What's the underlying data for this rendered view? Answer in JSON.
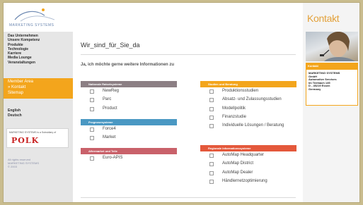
{
  "logo": {
    "text": "MARKETING SYSTEMS"
  },
  "nav": {
    "items": [
      "Das Unternehmen",
      "Unsere Kompetenz",
      "Produkte",
      "Technologie",
      "Karriere",
      "Media Lounge",
      "Veranstaltungen"
    ],
    "active": [
      "Member Area",
      "» Kontakt",
      "Sitemap"
    ]
  },
  "languages": [
    "English",
    "Deutsch"
  ],
  "partner": {
    "small_text": "MARKETING SYSTEMS is a Subsidiary of",
    "logo_text": "POLK"
  },
  "copyright": [
    "All rights reserved",
    "MARKETING SYSTEMS",
    "© 2003"
  ],
  "main": {
    "title": "Wir_sind_für_Sie_da",
    "intro": "Ja, ich möchte gerne weitere Informationen zu"
  },
  "sections": {
    "left": [
      {
        "title": "Nationale Ratsetsysteme",
        "color": "#8c7f84",
        "options": [
          "NewReg",
          "Parc",
          "Product"
        ]
      },
      {
        "title": "Prognosesysteme",
        "color": "#4a98c3",
        "options": [
          "Force4",
          "Market"
        ]
      },
      {
        "title": "Aftermarket und Teile",
        "color": "#c9616a",
        "options": [
          "Euro-APIS"
        ]
      }
    ],
    "right": [
      {
        "title": "Studien und Beratung",
        "color": "#f3a51c",
        "options": [
          "Produktionsstudien",
          "Absatz- und Zulassungsstudien",
          "Modellpolitik",
          "Finanzstudie",
          "Individuelle Lösungen / Beratung"
        ]
      },
      {
        "title": "Regionale Informationssysteme",
        "color": "#e4583b",
        "options": [
          "AutoMap Headquarter",
          "AutoMap District",
          "AutoMap Dealer",
          "Händlernetzoptimierung"
        ]
      }
    ]
  },
  "kontakt": {
    "title": "Kontakt",
    "head": "Kontakt",
    "address": [
      "MARKETING SYSTEMS",
      "GmbH",
      "Automotive Services",
      "Im Teelbach 135",
      "D - 45219 Essen",
      "Germany"
    ]
  }
}
